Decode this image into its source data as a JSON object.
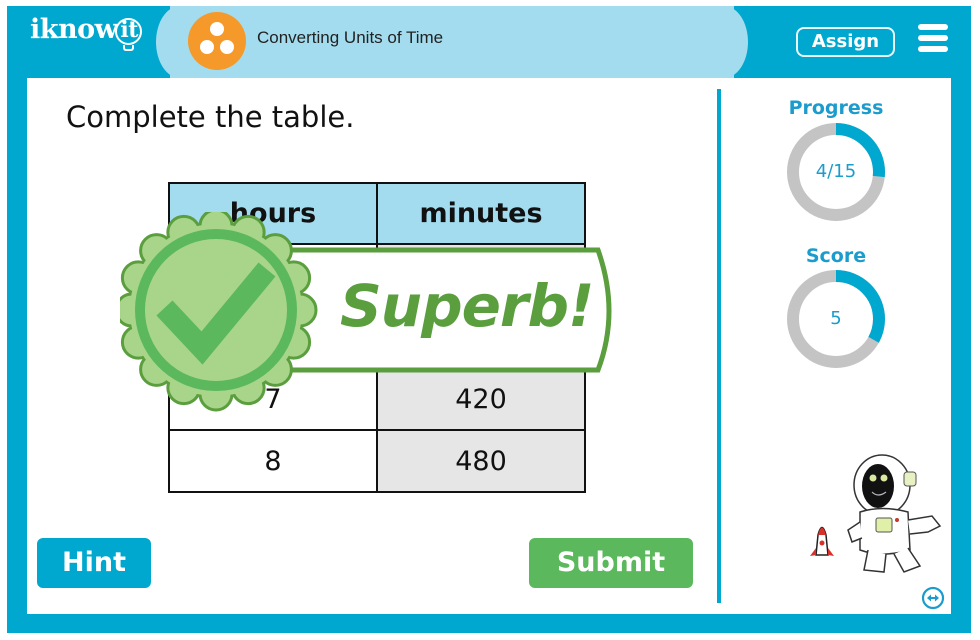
{
  "header": {
    "logo_text": "iknow",
    "logo_suffix": "it",
    "topic_icon": "three-dots-circle-icon",
    "topic_title": "Converting Units of Time",
    "assign_label": "Assign",
    "menu_icon": "hamburger-menu-icon"
  },
  "question": {
    "prompt": "Complete the table.",
    "table": {
      "columns": [
        "hours",
        "minutes"
      ],
      "rows": [
        [
          "",
          ""
        ],
        [
          "",
          ""
        ],
        [
          "7",
          "420"
        ],
        [
          "8",
          "480"
        ]
      ]
    }
  },
  "feedback": {
    "icon": "checkmark-seal-icon",
    "message": "Superb!"
  },
  "buttons": {
    "hint": "Hint",
    "submit": "Submit"
  },
  "sidebar": {
    "progress": {
      "label": "Progress",
      "text": "4/15",
      "current": 4,
      "total": 15
    },
    "score": {
      "label": "Score",
      "text": "5",
      "fraction": 0.33
    },
    "mascot": "astronaut-robot-mascot",
    "expand_icon": "expand-horizontal-icon"
  },
  "colors": {
    "frame": "#00a8cf",
    "header_pill": "#a2dcee",
    "topic_icon": "#f5992a",
    "accent_text": "#1b9ccc",
    "ring_track": "#c4c4c4",
    "success": "#5cb85c",
    "badge_green": "#5a9e3e",
    "answer_cell": "#e6e6e6"
  }
}
